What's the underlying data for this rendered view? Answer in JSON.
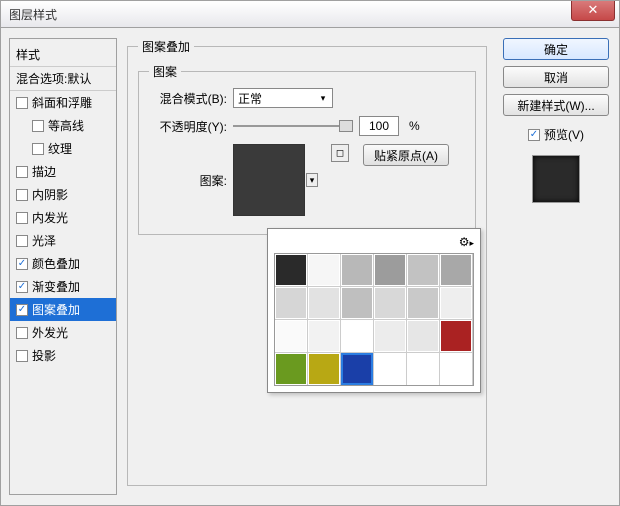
{
  "window": {
    "title": "图层样式",
    "close": "✕"
  },
  "left": {
    "header": "样式",
    "subheader": "混合选项:默认",
    "items": [
      {
        "label": "斜面和浮雕",
        "checked": false
      },
      {
        "label": "等高线",
        "checked": false,
        "sub": true
      },
      {
        "label": "纹理",
        "checked": false,
        "sub": true
      },
      {
        "label": "描边",
        "checked": false
      },
      {
        "label": "内阴影",
        "checked": false
      },
      {
        "label": "内发光",
        "checked": false
      },
      {
        "label": "光泽",
        "checked": false
      },
      {
        "label": "颜色叠加",
        "checked": true
      },
      {
        "label": "渐变叠加",
        "checked": true
      },
      {
        "label": "图案叠加",
        "checked": true,
        "selected": true
      },
      {
        "label": "外发光",
        "checked": false
      },
      {
        "label": "投影",
        "checked": false
      }
    ]
  },
  "center": {
    "outer_legend": "图案叠加",
    "inner_legend": "图案",
    "blend_label": "混合模式(B):",
    "blend_value": "正常",
    "opacity_label": "不透明度(Y):",
    "opacity_value": "100",
    "opacity_pct": "%",
    "pattern_label": "图案:",
    "snap_label": "贴紧原点(A)"
  },
  "picker": {
    "gear_icon": "⚙",
    "arrow": "▸",
    "swatches": [
      "#2a2a2a",
      "#f6f6f6",
      "#b8b8b8",
      "#9c9c9c",
      "#c2c2c2",
      "#a8a8a8",
      "#d6d6d6",
      "#e2e2e2",
      "#bfbfbf",
      "#d8d8d8",
      "#c9c9c9",
      "#eeeeee",
      "#fafafa",
      "#f2f2f2",
      "#ffffff",
      "#ececec",
      "#e6e6e6",
      "#aa2222",
      "#6a9a1f",
      "#b8a814",
      "#1a3fa8",
      "#ffffff",
      "#ffffff",
      "#ffffff"
    ],
    "selected_index": 20
  },
  "right": {
    "ok": "确定",
    "cancel": "取消",
    "new_style": "新建样式(W)...",
    "preview_label": "预览(V)",
    "preview_checked": true
  }
}
